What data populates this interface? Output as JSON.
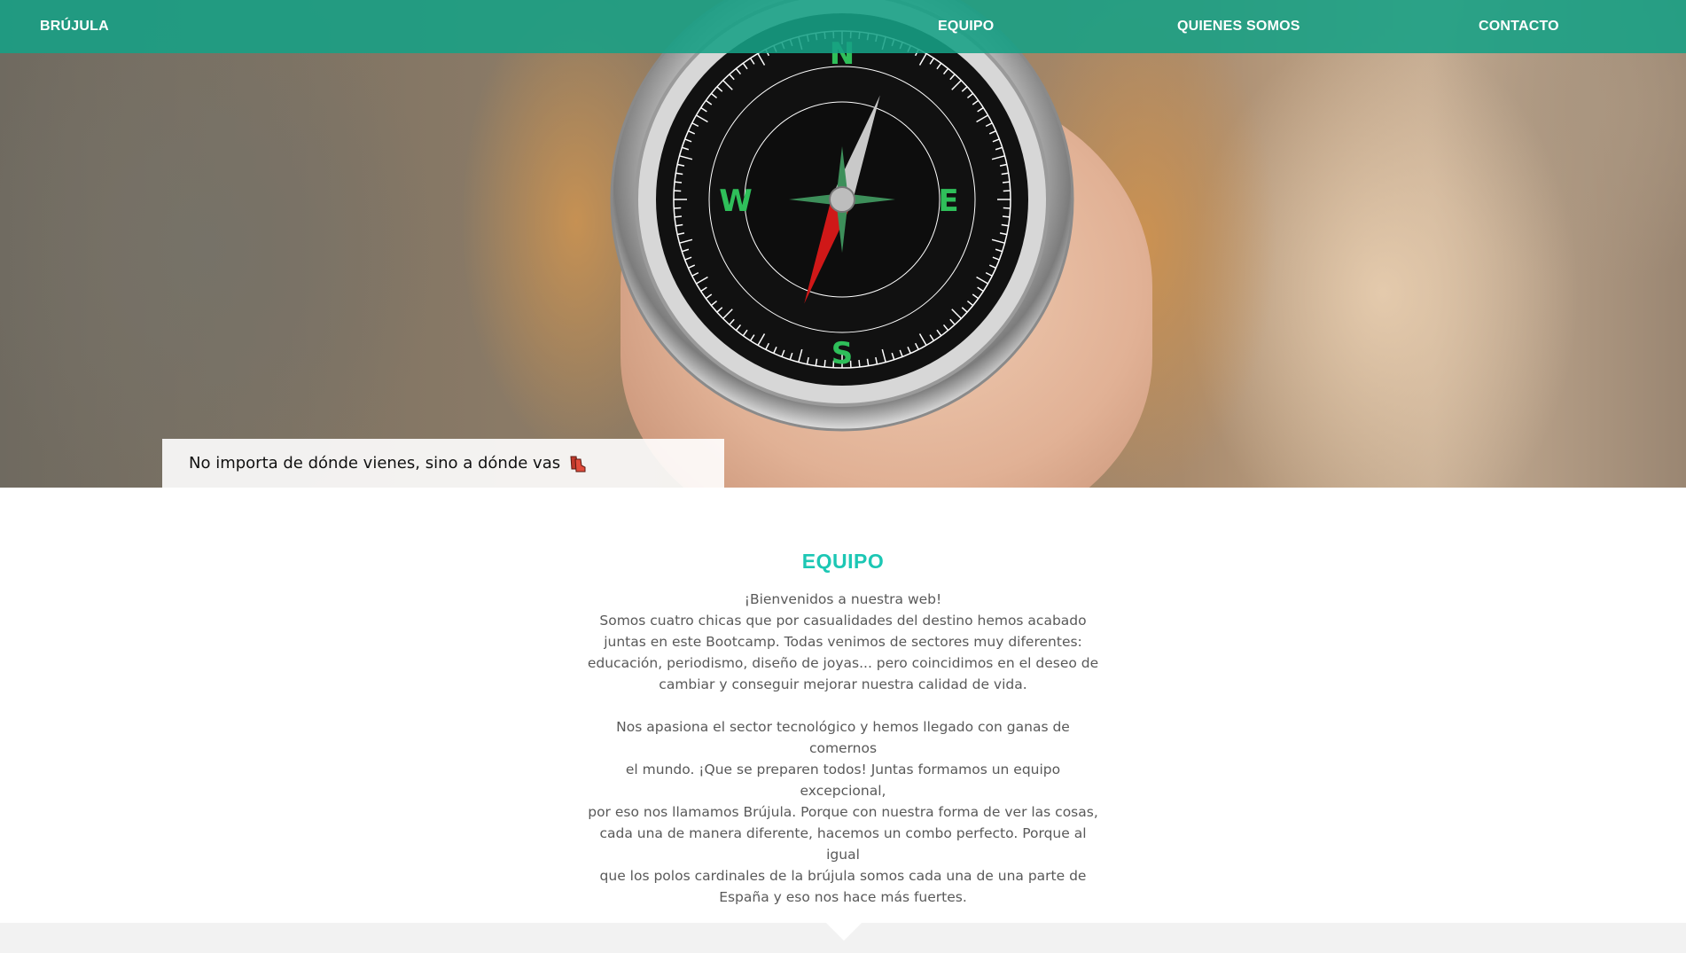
{
  "nav": {
    "brand": "BRÚJULA",
    "links": [
      "EQUIPO",
      "QUIENES SOMOS",
      "CONTACTO"
    ]
  },
  "hero": {
    "tagline": "No importa de dónde vienes, sino a dónde vas",
    "tagline_icon": "hiking-boots-icon",
    "compass_icon": "compass-image"
  },
  "section": {
    "title": "EQUIPO",
    "paragraph_1": [
      "¡Bienvenidos a nuestra web!",
      "Somos cuatro chicas que por casualidades del destino hemos acabado",
      "juntas en este Bootcamp. Todas venimos de sectores muy diferentes:",
      "educación, periodismo, diseño de joyas... pero coincidimos en el deseo de",
      "cambiar y conseguir mejorar nuestra calidad de vida."
    ],
    "paragraph_2": [
      "Nos apasiona el sector tecnológico y hemos llegado con ganas de comernos",
      "el mundo. ¡Que se preparen todos! Juntas formamos un equipo excepcional,",
      "por eso nos llamamos Brújula. Porque con nuestra forma de ver las cosas,",
      "cada una de manera diferente, hacemos un combo perfecto. Porque al igual",
      "que los polos cardinales de la brújula somos cada una de una parte de",
      "España y eso nos hace más fuertes."
    ]
  },
  "colors": {
    "nav_bg": "#16a085",
    "accent": "#1cc7b4",
    "body_text": "#595959",
    "footer_bg": "#f2f2f2"
  }
}
